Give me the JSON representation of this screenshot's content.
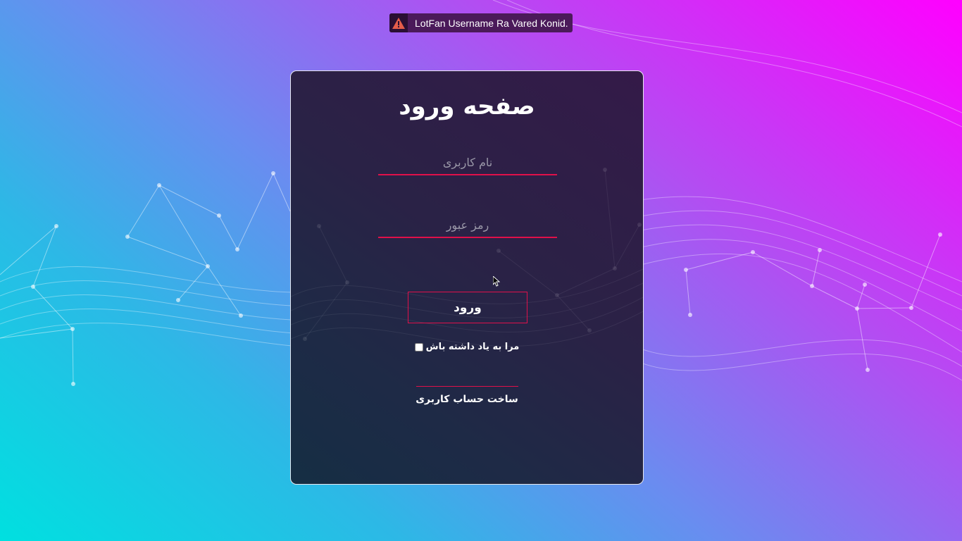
{
  "toast": {
    "message": "LotFan Username Ra Vared Konid.",
    "icon": "warning-icon",
    "icon_color": "#e35d4a"
  },
  "login": {
    "title": "صفحه ورود",
    "username_placeholder": "نام کاربری",
    "username_value": "",
    "password_placeholder": "رمز عبور",
    "password_value": "",
    "submit_label": "ورود",
    "remember_label": "مرا به یاد داشته باش",
    "remember_checked": false,
    "signup_label": "ساخت حساب کاربری"
  },
  "colors": {
    "accent": "#e0104a",
    "card_bg": "#2a2246",
    "gradient_start": "#00e0e0",
    "gradient_end": "#ff00ff"
  }
}
